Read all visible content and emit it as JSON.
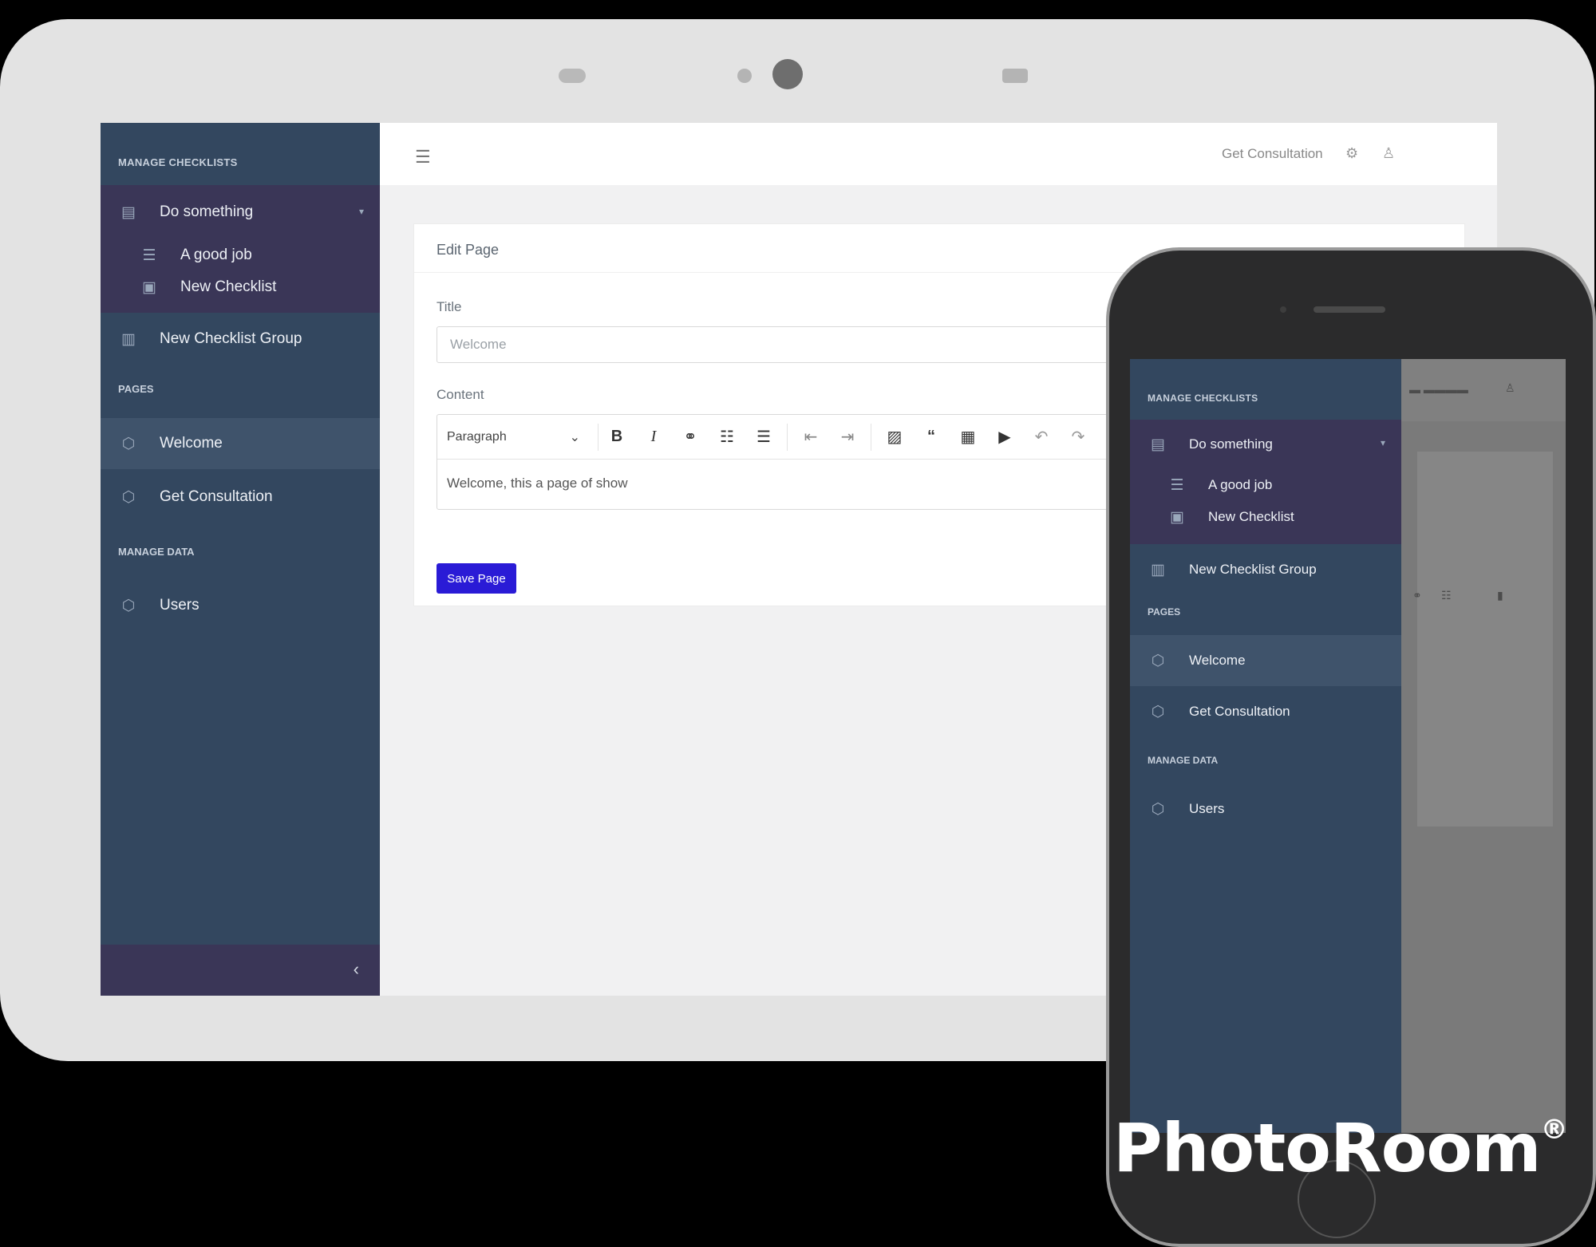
{
  "sidebar": {
    "section_checklists": "MANAGE CHECKLISTS",
    "group": {
      "label": "Do something",
      "children": [
        "A good job",
        "New Checklist"
      ]
    },
    "new_group": "New Checklist Group",
    "section_pages": "PAGES",
    "pages": [
      "Welcome",
      "Get Consultation"
    ],
    "section_data": "MANAGE DATA",
    "data_items": [
      "Users"
    ],
    "collapse_icon": "chevron-left-icon"
  },
  "topbar": {
    "menu_icon": "hamburger-icon",
    "link": "Get Consultation",
    "icons": [
      "settings-icon",
      "user-icon"
    ]
  },
  "card": {
    "title": "Edit Page",
    "title_label": "Title",
    "title_value": "Welcome",
    "content_label": "Content",
    "editor_style": "Paragraph",
    "editor_content": "Welcome, this a page of show",
    "save_label": "Save Page"
  },
  "colors": {
    "sidebar": "#33475f",
    "group_bg": "#3a3657",
    "accent_button": "#2a1bd6"
  },
  "watermark": {
    "text": "PhotoRoom",
    "mark": "®"
  }
}
